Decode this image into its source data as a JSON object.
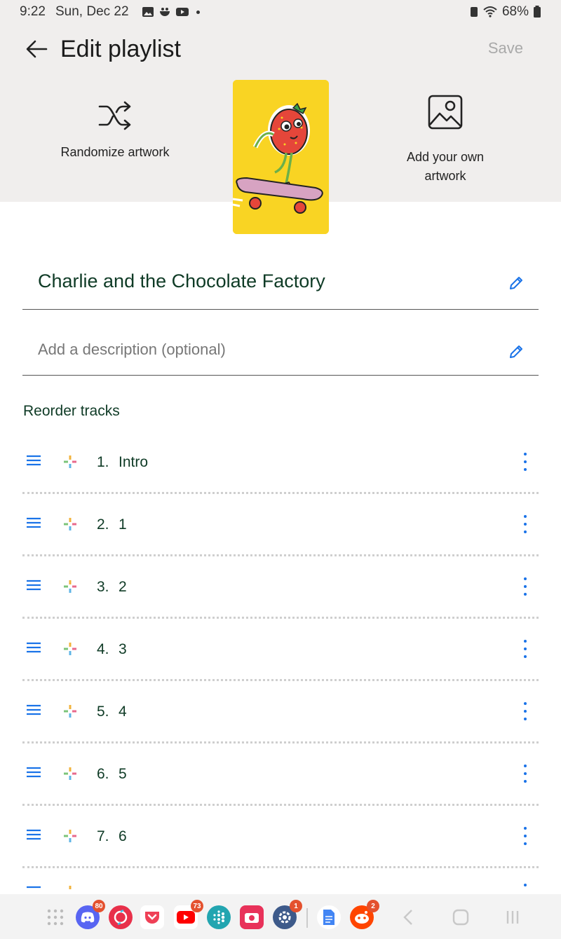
{
  "status_bar": {
    "time": "9:22",
    "date": "Sun, Dec 22",
    "battery": "68%"
  },
  "header": {
    "title": "Edit playlist",
    "save_label": "Save",
    "randomize_label": "Randomize artwork",
    "add_own_label_line1": "Add your own",
    "add_own_label_line2": "artwork"
  },
  "playlist": {
    "name": "Charlie and the Chocolate Factory",
    "description_placeholder": "Add a description (optional)"
  },
  "reorder": {
    "title": "Reorder tracks",
    "tracks": [
      {
        "num": "1.",
        "name": "Intro"
      },
      {
        "num": "2.",
        "name": "1"
      },
      {
        "num": "3.",
        "name": "2"
      },
      {
        "num": "4.",
        "name": "3"
      },
      {
        "num": "5.",
        "name": "4"
      },
      {
        "num": "6.",
        "name": "5"
      },
      {
        "num": "7.",
        "name": "6"
      }
    ]
  },
  "navbar": {
    "apps": [
      {
        "name": "app-grid-icon"
      },
      {
        "name": "discord-icon",
        "badge": "80"
      },
      {
        "name": "sync-icon"
      },
      {
        "name": "pocket-icon"
      },
      {
        "name": "youtube-icon",
        "badge": "73"
      },
      {
        "name": "fitbit-icon"
      },
      {
        "name": "camera-icon"
      },
      {
        "name": "settings-icon",
        "badge": "1"
      },
      {
        "name": "docs-icon"
      },
      {
        "name": "reddit-icon",
        "badge": "2"
      }
    ]
  },
  "colors": {
    "accent": "#1a73e8",
    "text_dark_green": "#0f3b26",
    "header_bg": "#f0eeed",
    "artwork_bg": "#f9d423"
  }
}
